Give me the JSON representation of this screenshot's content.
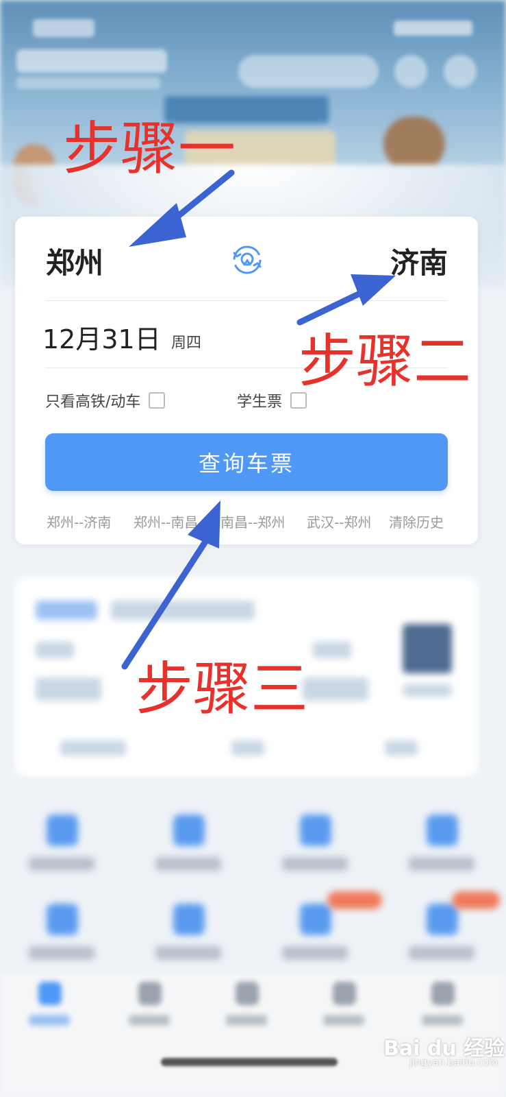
{
  "search": {
    "from_city": "郑州",
    "to_city": "济南",
    "date": "12月31日",
    "weekday": "周四",
    "option_gaotie": "只看高铁/动车",
    "option_student": "学生票",
    "query_button": "查询车票"
  },
  "history": {
    "items": [
      "郑州--济南",
      "郑州--南昌",
      "南昌--郑州",
      "武汉--郑州"
    ],
    "clear": "清除历史"
  },
  "annotations": {
    "step1": "步骤一",
    "step2": "步骤二",
    "step3": "步骤三",
    "arrow_color": "#3b63d1",
    "text_color": "#e8312b"
  },
  "icons": {
    "swap": "swap-cities-icon"
  },
  "watermark": {
    "brand": "Bai du 经验",
    "url": "jingyan.baidu.com"
  },
  "colors": {
    "primary_button": "#4f98f5"
  }
}
